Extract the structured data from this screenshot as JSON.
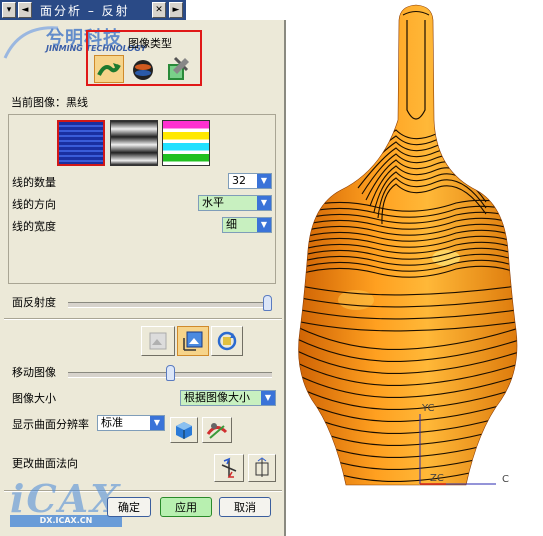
{
  "window": {
    "title": "面分析 – 反射",
    "nav_prev": "◄",
    "nav_next": "►"
  },
  "watermark": {
    "brand_cn": "兮明科技",
    "brand_en": "JINMING TECHNOLOGY",
    "brand_bottom": "iCAX",
    "brand_bottom_url": "DX.ICAX.CN"
  },
  "image_type": {
    "label": "图像类型",
    "options": [
      "scene-image",
      "environment-image",
      "user-image"
    ]
  },
  "current_image": {
    "label": "当前图像：黑线"
  },
  "line_settings": {
    "count_label": "线的数量",
    "count_value": "32",
    "direction_label": "线的方向",
    "direction_value": "水平",
    "width_label": "线的宽度",
    "width_value": "细"
  },
  "reflectivity": {
    "label": "面反射度",
    "level": 1.0
  },
  "move_image": {
    "label": "移动图像",
    "level": 0.5
  },
  "image_size": {
    "label": "图像大小",
    "value": "根据图像大小"
  },
  "resolution": {
    "label": "显示曲面分辨率",
    "value": "标准"
  },
  "normal": {
    "label": "更改曲面法向"
  },
  "buttons": {
    "ok": "确定",
    "apply": "应用",
    "cancel": "取消"
  },
  "viewport": {
    "axis_yc": "YC",
    "axis_zc": "ZC",
    "axis_xc": "C",
    "colors": {
      "surface": "#f28c12",
      "lines": "#1a0e00",
      "highlight": "#ffd060"
    }
  }
}
